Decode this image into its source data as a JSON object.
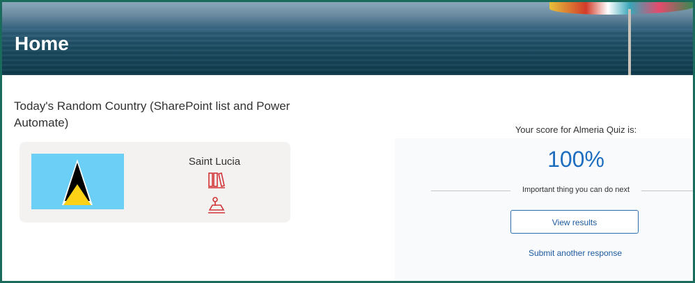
{
  "header": {
    "title": "Home"
  },
  "random_country": {
    "section_title": "Today's Random Country (SharePoint list and Power Automate)",
    "country_name": "Saint Lucia",
    "icons": [
      "books-icon",
      "map-pin-icon"
    ],
    "flag_colors": {
      "field": "#6ccff6",
      "white": "#ffffff",
      "black": "#000000",
      "gold": "#fcd116"
    }
  },
  "quiz": {
    "score_label": "Your score for Almeria Quiz is:",
    "score_value": "100%",
    "next_label": "Important thing you can do next",
    "view_results_label": "View results",
    "submit_another_label": "Submit another response"
  },
  "colors": {
    "accent": "#1e6ec0",
    "icon_red": "#d13438",
    "frame": "#1a6b5c"
  }
}
